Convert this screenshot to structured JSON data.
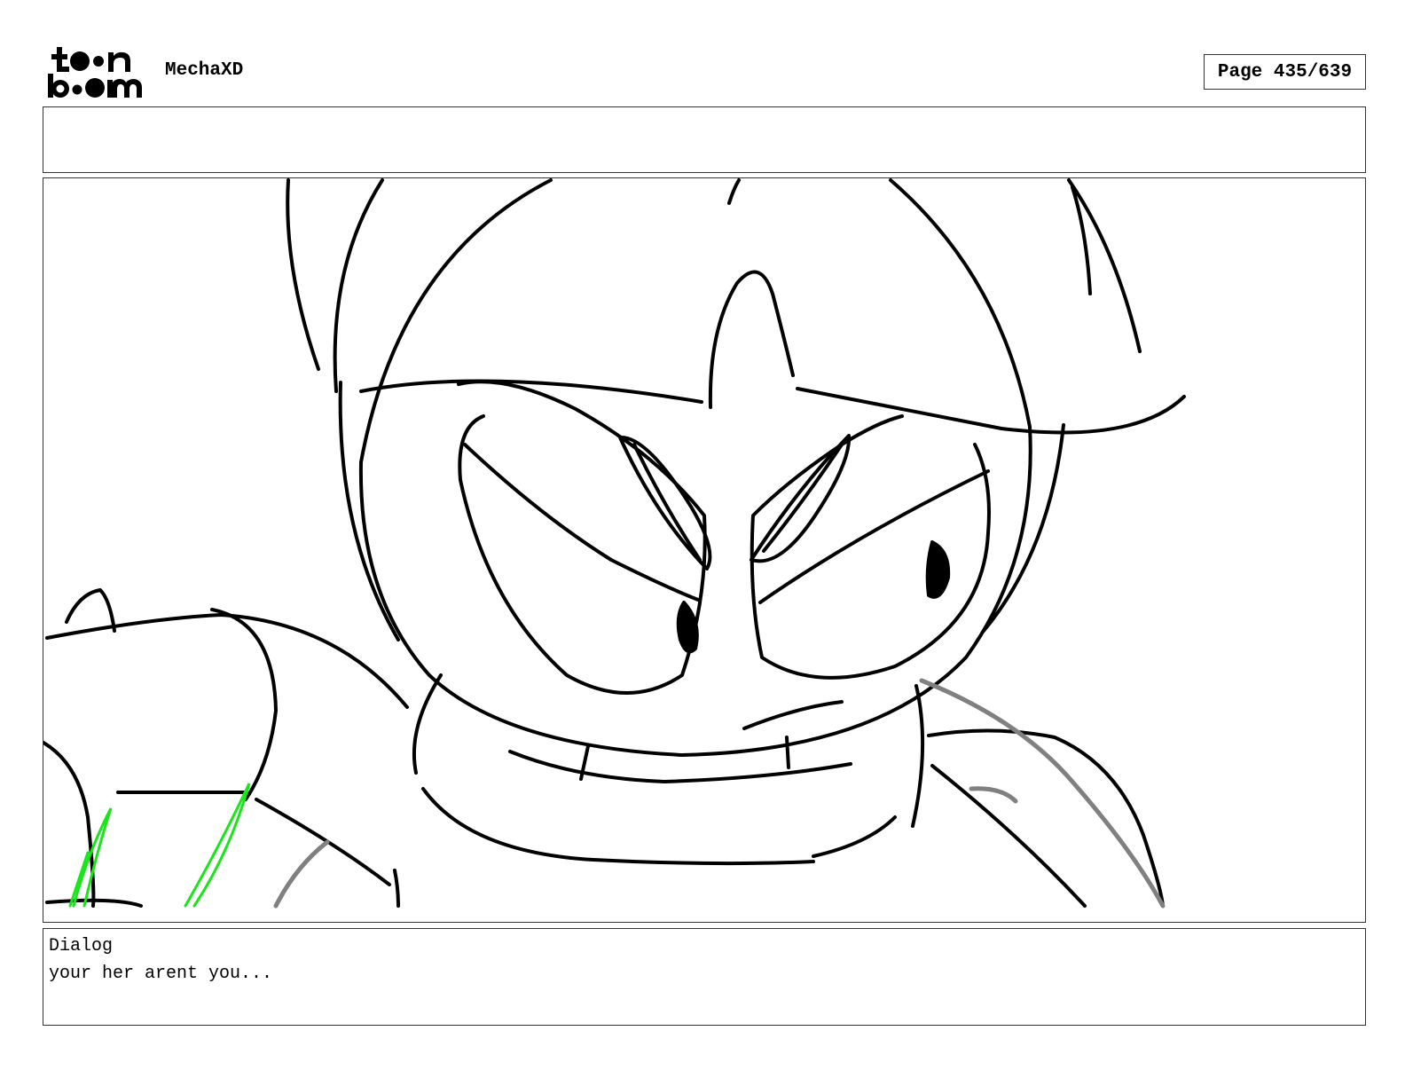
{
  "header": {
    "logo_text": "toon boom",
    "project_title": "MechaXD",
    "page_label": "Page 435/639"
  },
  "notes": {
    "text": ""
  },
  "panel": {
    "image_description": ""
  },
  "dialog": {
    "heading": "Dialog",
    "text": "your her arent you..."
  },
  "colors": {
    "ink": "#000000",
    "grey_ink": "#808080",
    "green_mark": "#19e619",
    "border": "#333333"
  }
}
